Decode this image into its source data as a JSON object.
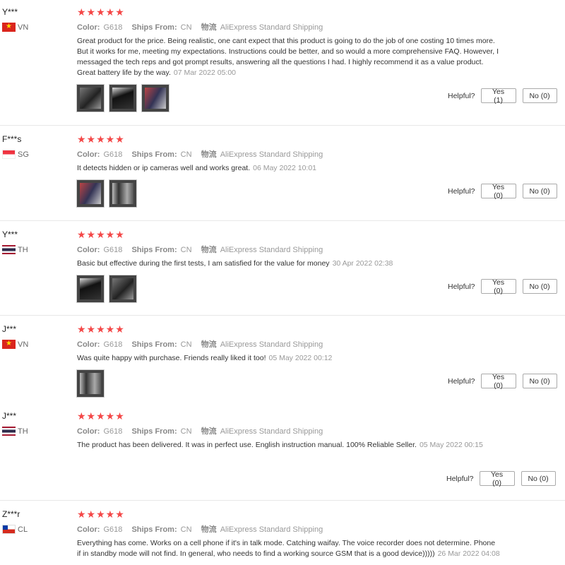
{
  "helpful_label": "Helpful?",
  "meta_labels": {
    "color": "Color:",
    "ships": "Ships From:",
    "logistics": "物流"
  },
  "reviews": [
    {
      "user": "Y***",
      "country": "VN",
      "stars": "★★★★★",
      "rating": 4.5,
      "color": "G618",
      "ships": "CN",
      "shipping": "AliExpress Standard Shipping",
      "text": "Great product for the price. Being realistic, one cant expect that this product is going to do the job of one costing 10 times more. But it works for me, meeting my expectations. Instructions could be better, and so would a more comprehensive FAQ. However, I messaged the tech reps and got prompt results, answering all the questions I had. I highly recommend it as a value product. Great battery life by the way.",
      "date": "07 Mar 2022 05:00",
      "yes": "Yes (1)",
      "no": "No (0)"
    },
    {
      "user": "F***s",
      "country": "SG",
      "stars": "★★★★★",
      "rating": 5,
      "color": "G618",
      "ships": "CN",
      "shipping": "AliExpress Standard Shipping",
      "text": "It detects hidden or ip cameras well and works great.",
      "date": "06 May 2022 10:01",
      "yes": "Yes (0)",
      "no": "No (0)"
    },
    {
      "user": "Y***",
      "country": "TH",
      "stars": "★★★★★",
      "rating": 5,
      "color": "G618",
      "ships": "CN",
      "shipping": "AliExpress Standard Shipping",
      "text": "Basic but effective during the first tests, I am satisfied for the value for money",
      "date": "30 Apr 2022 02:38",
      "yes": "Yes (0)",
      "no": "No (0)"
    },
    {
      "user": "J***",
      "country": "VN",
      "stars": "★★★★★",
      "rating": 4.5,
      "color": "G618",
      "ships": "CN",
      "shipping": "AliExpress Standard Shipping",
      "text": "Was quite happy with purchase. Friends really liked it too!",
      "date": "05 May 2022 00:12",
      "yes": "Yes (0)",
      "no": "No (0)"
    },
    {
      "user": "J***",
      "country": "TH",
      "stars": "★★★★★",
      "rating": 5,
      "color": "G618",
      "ships": "CN",
      "shipping": "AliExpress Standard Shipping",
      "text": "The product has been delivered. It was in perfect use. English instruction manual. 100% Reliable Seller.",
      "date": "05 May 2022 00:15",
      "yes": "Yes (0)",
      "no": "No (0)"
    },
    {
      "user": "Z***r",
      "country": "CL",
      "stars": "★★★★★",
      "rating": 5,
      "color": "G618",
      "ships": "CN",
      "shipping": "AliExpress Standard Shipping",
      "text": "Everything has come. Works on a cell phone if it's in talk mode. Catching waifay. The voice recorder does not determine. Phone if in standby mode will not find. In general, who needs to find a working source GSM that is a good device)))))",
      "date": "26 Mar 2022 04:08"
    }
  ]
}
